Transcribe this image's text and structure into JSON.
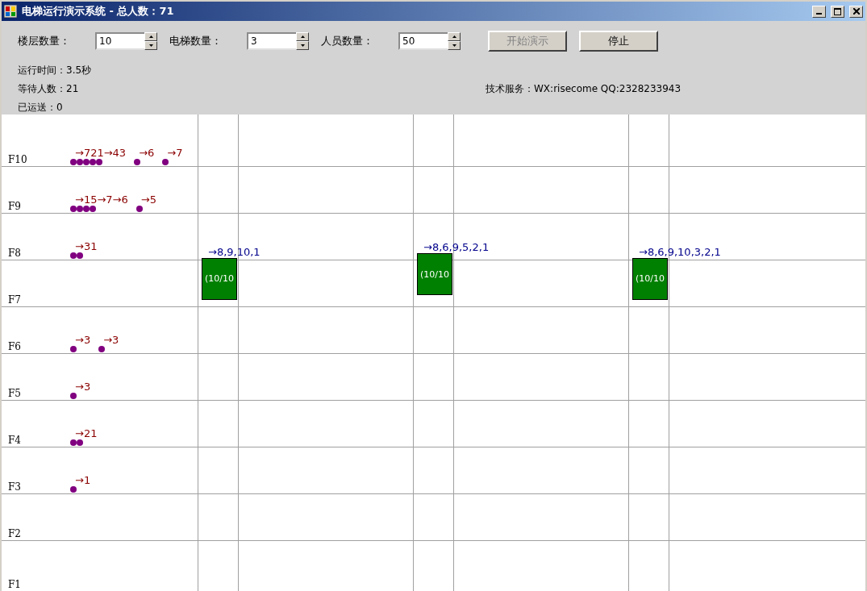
{
  "window": {
    "title": "电梯运行演示系统 - 总人数：71"
  },
  "settings": [
    {
      "label": "楼层数量：",
      "value": "10"
    },
    {
      "label": "电梯数量：",
      "value": "3"
    },
    {
      "label": "人员数量：",
      "value": "50"
    }
  ],
  "buttons": [
    {
      "label": "开始演示",
      "disabled": true
    },
    {
      "label": "停止",
      "disabled": false
    }
  ],
  "stats": [
    "运行时间：3.5秒",
    "等待人数：21",
    "已运送：0"
  ],
  "service": "技术服务：WX:risecome  QQ:2328233943",
  "floors": [
    {
      "label": "F10",
      "groups": [
        {
          "label": "→721→43",
          "persons": [
            {
              "kind": "passenger"
            },
            {
              "kind": "passenger"
            },
            {
              "kind": "passenger"
            },
            {
              "kind": "passenger"
            },
            {
              "kind": "passenger"
            }
          ]
        },
        {
          "label": "→6",
          "persons": [
            {
              "kind": "passenger"
            }
          ]
        },
        {
          "label": "→7",
          "persons": [
            {
              "kind": "passenger"
            }
          ]
        }
      ]
    },
    {
      "label": "F9",
      "groups": [
        {
          "label": "→15→7→6",
          "persons": [
            {
              "kind": "passenger"
            },
            {
              "kind": "passenger"
            },
            {
              "kind": "passenger"
            },
            {
              "kind": "passenger"
            }
          ]
        },
        {
          "label": "→5",
          "persons": [
            {
              "kind": "passenger"
            }
          ]
        }
      ]
    },
    {
      "label": "F8",
      "groups": [
        {
          "label": "→31",
          "persons": [
            {
              "kind": "passenger"
            },
            {
              "kind": "passenger"
            }
          ]
        }
      ]
    },
    {
      "label": "F7"
    },
    {
      "label": "F6",
      "groups": [
        {
          "label": "→3",
          "persons": [
            {
              "kind": "passenger"
            }
          ]
        },
        {
          "label": "→3",
          "persons": [
            {
              "kind": "passenger"
            }
          ]
        }
      ]
    },
    {
      "label": "F5",
      "groups": [
        {
          "label": "→3",
          "persons": [
            {
              "kind": "passenger"
            }
          ]
        }
      ]
    },
    {
      "label": "F4",
      "groups": [
        {
          "label": "→21",
          "persons": [
            {
              "kind": "passenger"
            },
            {
              "kind": "passenger"
            }
          ]
        }
      ]
    },
    {
      "label": "F3",
      "groups": [
        {
          "label": "→1",
          "persons": [
            {
              "kind": "passenger"
            }
          ]
        }
      ]
    },
    {
      "label": "F2"
    },
    {
      "label": "F1"
    }
  ],
  "elevators": [
    {
      "level": 0.611,
      "load": "(10/10",
      "queue": "→8,9,10,1"
    },
    {
      "level": 0.621,
      "load": "(10/10",
      "queue": "→8,6,9,5,2,1"
    },
    {
      "level": 0.611,
      "load": "(10/10",
      "queue": "→8,6,9,10,3,2,1"
    }
  ]
}
